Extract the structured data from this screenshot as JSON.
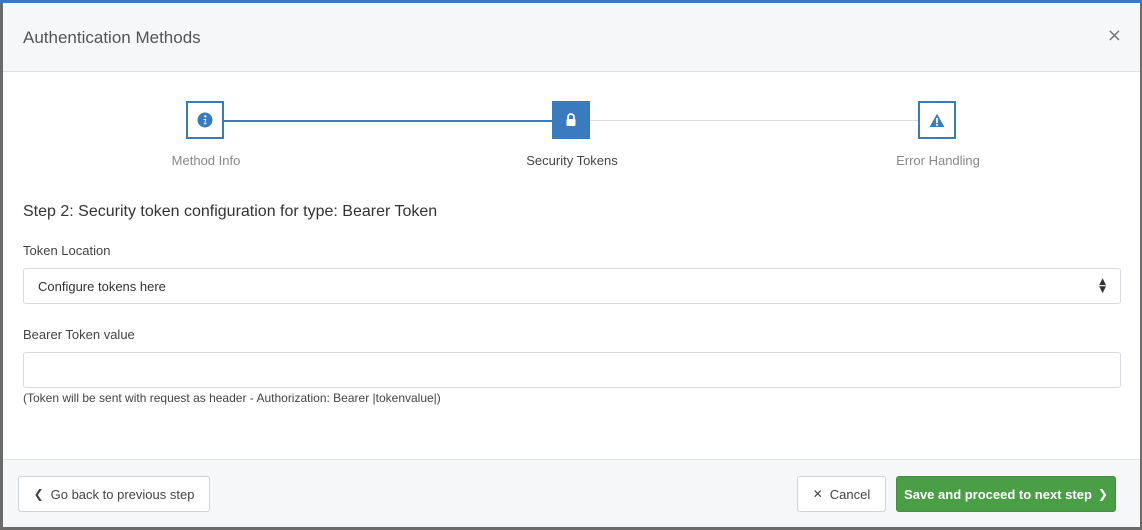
{
  "modal": {
    "title": "Authentication Methods",
    "close_icon": "×"
  },
  "wizard": {
    "steps": [
      {
        "label": "Method Info",
        "icon": "info-icon",
        "state": "completed"
      },
      {
        "label": "Security Tokens",
        "icon": "lock-icon",
        "state": "active"
      },
      {
        "label": "Error Handling",
        "icon": "warning-icon",
        "state": "pending"
      }
    ],
    "heading": "Step 2: Security token configuration for type: Bearer Token"
  },
  "form": {
    "token_location_label": "Token Location",
    "token_location_value": "Configure tokens here",
    "bearer_label": "Bearer Token value",
    "bearer_value": "",
    "hint": "(Token will be sent with request as header - Authorization: Bearer |tokenvalue|)"
  },
  "footer": {
    "back_label": "Go back to previous step",
    "cancel_label": "Cancel",
    "save_label": "Save and proceed to next step"
  },
  "colors": {
    "accent": "#3a7bbf",
    "success": "#4a9e45"
  }
}
